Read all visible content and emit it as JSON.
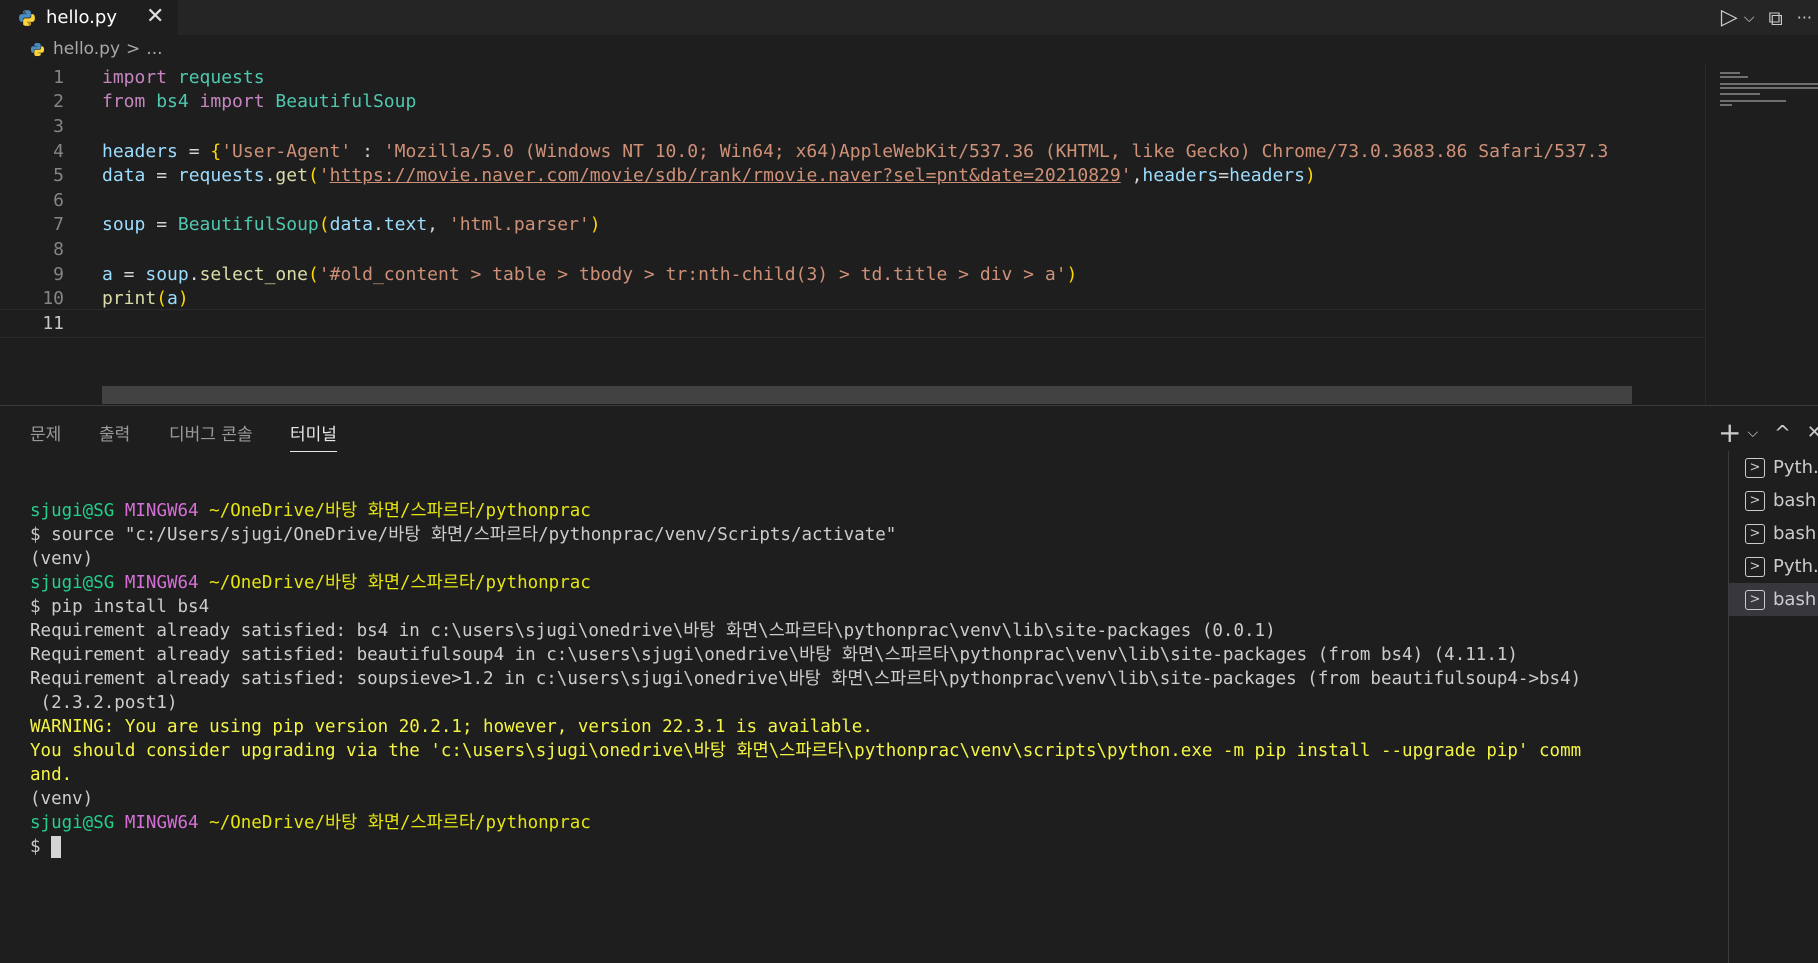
{
  "tab": {
    "filename": "hello.py",
    "close": "✕"
  },
  "toolbar": {
    "run": "▷",
    "dropdown": "⌵",
    "split": "⧉",
    "more": "···"
  },
  "breadcrumb": {
    "file": "hello.py",
    "sep": ">",
    "rest": "..."
  },
  "editor": {
    "lines": [
      {
        "n": "1"
      },
      {
        "n": "2"
      },
      {
        "n": "3"
      },
      {
        "n": "4"
      },
      {
        "n": "5"
      },
      {
        "n": "6"
      },
      {
        "n": "7"
      },
      {
        "n": "8"
      },
      {
        "n": "9"
      },
      {
        "n": "10"
      },
      {
        "n": "11"
      }
    ],
    "code": {
      "l1_kw": "import",
      "l1_mod": " requests",
      "l2_kw1": "from",
      "l2_mod": " bs4 ",
      "l2_kw2": "import",
      "l2_cls": " BeautifulSoup",
      "l4_var": "headers",
      "l4_eq": " = ",
      "l4_brace": "{",
      "l4_key": "'User-Agent'",
      "l4_colon": " : ",
      "l4_val": "'Mozilla/5.0 (Windows NT 10.0; Win64; x64)AppleWebKit/537.36 (KHTML, like Gecko) Chrome/73.0.3683.86 Safari/537.3",
      "l5_var": "data",
      "l5_eq": " = ",
      "l5_mod": "requests",
      "l5_dot": ".",
      "l5_fn": "get",
      "l5_po": "(",
      "l5_q1": "'",
      "l5_url": "https://movie.naver.com/movie/sdb/rank/rmovie.naver?sel=pnt&date=20210829",
      "l5_q2": "'",
      "l5_comma": ",",
      "l5_kwarg": "headers",
      "l5_eq2": "=",
      "l5_arg": "headers",
      "l5_pc": ")",
      "l7_var": "soup",
      "l7_eq": " = ",
      "l7_cls": "BeautifulSoup",
      "l7_po": "(",
      "l7_arg": "data",
      "l7_dot": ".",
      "l7_attr": "text",
      "l7_comma": ", ",
      "l7_str": "'html.parser'",
      "l7_pc": ")",
      "l9_var": "a",
      "l9_eq": " = ",
      "l9_obj": "soup",
      "l9_dot": ".",
      "l9_fn": "select_one",
      "l9_po": "(",
      "l9_str": "'#old_content > table > tbody > tr:nth-child(3) > td.title > div > a'",
      "l9_pc": ")",
      "l10_fn": "print",
      "l10_po": "(",
      "l10_arg": "a",
      "l10_pc": ")"
    }
  },
  "panel": {
    "tabs": [
      "문제",
      "출력",
      "디버그 콘솔",
      "터미널"
    ],
    "actions": {
      "add": "+",
      "dropdown": "⌵",
      "maximize": "^",
      "close": "✕"
    }
  },
  "terminal": {
    "prompt_user": "sjugi@SG",
    "prompt_env": "MINGW64",
    "prompt_path": "~/OneDrive/바탕 화면/스파르타/pythonprac",
    "cmd1": "$ source \"c:/Users/sjugi/OneDrive/바탕 화면/스파르타/pythonprac/venv/Scripts/activate\"",
    "venv": "(venv)",
    "cmd2": "$ pip install bs4",
    "out1": "Requirement already satisfied: bs4 in c:\\users\\sjugi\\onedrive\\바탕 화면\\스파르타\\pythonprac\\venv\\lib\\site-packages (0.0.1)",
    "out2": "Requirement already satisfied: beautifulsoup4 in c:\\users\\sjugi\\onedrive\\바탕 화면\\스파르타\\pythonprac\\venv\\lib\\site-packages (from bs4) (4.11.1)",
    "out3a": "Requirement already satisfied: soupsieve>1.2 in c:\\users\\sjugi\\onedrive\\바탕 화면\\스파르타\\pythonprac\\venv\\lib\\site-packages (from beautifulsoup4->bs4)",
    "out3b": " (2.3.2.post1)",
    "warn1": "WARNING: You are using pip version 20.2.1; however, version 22.3.1 is available.",
    "warn2a": "You should consider upgrading via the 'c:\\users\\sjugi\\onedrive\\바탕 화면\\스파르타\\pythonprac\\venv\\scripts\\python.exe -m pip install --upgrade pip' comm",
    "warn2b": "and.",
    "prompt_final": "$ "
  },
  "terminal_list": [
    {
      "icon": ">",
      "label": "Pyth..."
    },
    {
      "icon": ">",
      "label": "bash"
    },
    {
      "icon": ">",
      "label": "bash"
    },
    {
      "icon": ">",
      "label": "Pyth..."
    },
    {
      "icon": ">",
      "label": "bash"
    }
  ]
}
